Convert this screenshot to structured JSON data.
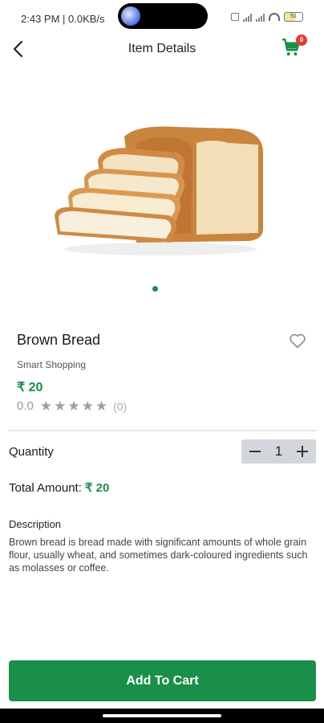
{
  "status_bar": {
    "time": "2:43 PM | 0.0KB/s",
    "battery": "51"
  },
  "header": {
    "title": "Item Details",
    "cart_count": "0"
  },
  "product": {
    "name": "Brown Bread",
    "brand": "Smart Shopping",
    "price": "₹ 20",
    "rating_value": "0.0",
    "rating_stars": 0,
    "rating_count": "(0)",
    "image_icon": "bread-loaf-image"
  },
  "quantity": {
    "label": "Quantity",
    "value": "1"
  },
  "total": {
    "label": "Total Amount:",
    "amount": "₹ 20"
  },
  "description": {
    "label": "Description",
    "text": "Brown bread is bread made with significant amounts of whole grain flour, usually wheat, and sometimes dark-coloured ingredients such as molasses or coffee."
  },
  "actions": {
    "add_to_cart": "Add To Cart"
  },
  "colors": {
    "accent": "#1a8f4a",
    "badge": "#e53935",
    "stepper_bg": "#d3d6da"
  }
}
